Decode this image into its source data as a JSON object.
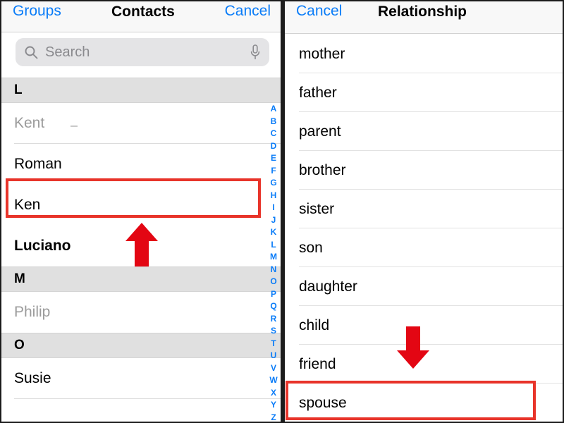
{
  "left_panel": {
    "nav": {
      "back_label": "Groups",
      "title": "Contacts",
      "cancel_label": "Cancel"
    },
    "search": {
      "placeholder": "Search",
      "search_icon": "search-icon",
      "mic_icon": "microphone-icon"
    },
    "list": [
      {
        "type": "header",
        "label": "L"
      },
      {
        "type": "contact",
        "label": "Kent",
        "style": "dim"
      },
      {
        "type": "contact",
        "label": "Roman",
        "style": "normal"
      },
      {
        "type": "contact",
        "label": "Ken",
        "style": "normal"
      },
      {
        "type": "contact",
        "label": "Luciano",
        "style": "bold"
      },
      {
        "type": "header",
        "label": "M"
      },
      {
        "type": "contact",
        "label": "Philip",
        "style": "dim"
      },
      {
        "type": "header",
        "label": "O"
      },
      {
        "type": "contact",
        "label": "Susie",
        "style": "normal"
      }
    ],
    "index_letters": [
      "A",
      "B",
      "C",
      "D",
      "E",
      "F",
      "G",
      "H",
      "I",
      "J",
      "K",
      "L",
      "M",
      "N",
      "O",
      "P",
      "Q",
      "R",
      "S",
      "T",
      "U",
      "V",
      "W",
      "X",
      "Y",
      "Z"
    ]
  },
  "right_panel": {
    "nav": {
      "cancel_label": "Cancel",
      "title": "Relationship"
    },
    "options": [
      "mother",
      "father",
      "parent",
      "brother",
      "sister",
      "son",
      "daughter",
      "child",
      "friend",
      "spouse"
    ]
  },
  "annotations": {
    "highlight_color": "#e8342a",
    "arrow_color": "#e30613",
    "highlighted_contact": "Ken",
    "highlighted_option": "spouse",
    "arrow_up_name": "up-arrow-annotation",
    "arrow_down_name": "down-arrow-annotation"
  },
  "theme": {
    "accent_blue": "#0a7cf8",
    "section_header_bg": "#e0e0e0",
    "navbar_bg": "#f8f8f8",
    "search_bg": "#e4e4e6"
  }
}
